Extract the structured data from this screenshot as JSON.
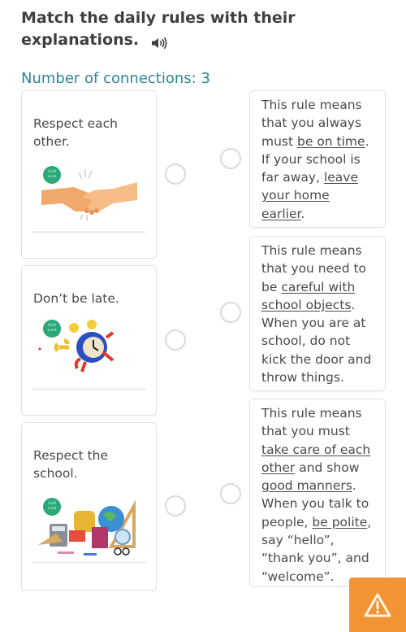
{
  "header": {
    "title": "Match the daily rules with their explanations.",
    "audio_icon": "speaker-icon",
    "connections_label": "Number of connections: 3"
  },
  "left_items": [
    {
      "text": "Respect each other.",
      "image": "handshake illustration",
      "badge": "GLM Land"
    },
    {
      "text": "Don’t be late.",
      "image": "running alarm clock illustration",
      "badge": "GLM Land"
    },
    {
      "text": "Respect the school.",
      "image": "school supplies illustration",
      "badge": "GLM Land"
    }
  ],
  "right_items": [
    {
      "segments": [
        {
          "t": "This rule means that you always must ",
          "u": false
        },
        {
          "t": "be on time",
          "u": true
        },
        {
          "t": ". If your school is far away, ",
          "u": false
        },
        {
          "t": "leave your home earlier",
          "u": true
        },
        {
          "t": ".",
          "u": false
        }
      ]
    },
    {
      "segments": [
        {
          "t": "This rule means that you need to be ",
          "u": false
        },
        {
          "t": "careful with school objects",
          "u": true
        },
        {
          "t": ". When you are at school, do not kick the door and throw things.",
          "u": false
        }
      ]
    },
    {
      "segments": [
        {
          "t": "This rule means that you must ",
          "u": false
        },
        {
          "t": "take care of each other",
          "u": true
        },
        {
          "t": " and show ",
          "u": false
        },
        {
          "t": "good manners",
          "u": true
        },
        {
          "t": ". When you talk to people, ",
          "u": false
        },
        {
          "t": "be polite",
          "u": true
        },
        {
          "t": ", say “hello”, “thank you”, and “welcome”.",
          "u": false
        }
      ]
    }
  ],
  "report_button": {
    "icon": "warning-icon"
  },
  "colors": {
    "title": "#3d3f42",
    "accent": "#2e8599",
    "warning": "#f39434",
    "badge": "#2aa877"
  }
}
